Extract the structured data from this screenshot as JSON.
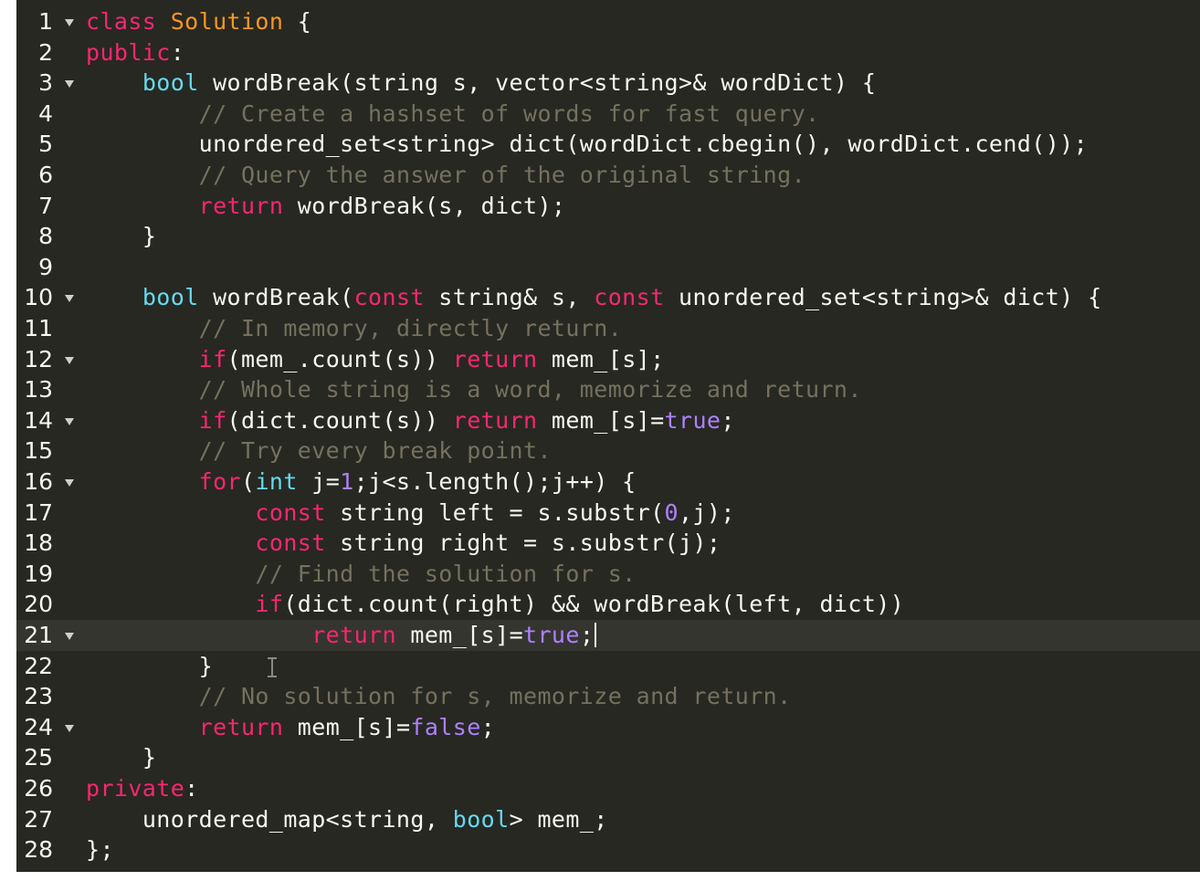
{
  "editor": {
    "language": "C++",
    "theme": "Monokai",
    "active_line": 21,
    "colors": {
      "background": "#272822",
      "active_line": "#353530",
      "keyword": "#f92672",
      "storage_type": "#66d9ef",
      "class_name": "#fd971f",
      "comment": "#75715e",
      "constant": "#ae81ff",
      "text": "#f8f8f2"
    },
    "lines": [
      {
        "n": "1",
        "fold": true,
        "indent": "",
        "tokens": [
          {
            "t": "class ",
            "c": "keyword"
          },
          {
            "t": "Solution",
            "c": "class"
          },
          {
            "t": " {",
            "c": "plain"
          }
        ]
      },
      {
        "n": "2",
        "fold": false,
        "indent": "",
        "tokens": [
          {
            "t": "public",
            "c": "keyword"
          },
          {
            "t": ":",
            "c": "plain"
          }
        ]
      },
      {
        "n": "3",
        "fold": true,
        "indent": "    ",
        "tokens": [
          {
            "t": "bool",
            "c": "storage"
          },
          {
            "t": " wordBreak(string s, vector<string>& wordDict) {",
            "c": "plain"
          }
        ]
      },
      {
        "n": "4",
        "fold": false,
        "indent": "        ",
        "tokens": [
          {
            "t": "// Create a hashset of words for fast query.",
            "c": "comment"
          }
        ]
      },
      {
        "n": "5",
        "fold": false,
        "indent": "        ",
        "tokens": [
          {
            "t": "unordered_set<string> dict(wordDict.cbegin(), wordDict.cend());",
            "c": "plain"
          }
        ]
      },
      {
        "n": "6",
        "fold": false,
        "indent": "        ",
        "tokens": [
          {
            "t": "// Query the answer of the original string.",
            "c": "comment"
          }
        ]
      },
      {
        "n": "7",
        "fold": false,
        "indent": "        ",
        "tokens": [
          {
            "t": "return",
            "c": "keyword"
          },
          {
            "t": " wordBreak(s, dict);",
            "c": "plain"
          }
        ]
      },
      {
        "n": "8",
        "fold": false,
        "indent": "    ",
        "tokens": [
          {
            "t": "}",
            "c": "plain"
          }
        ]
      },
      {
        "n": "9",
        "fold": false,
        "indent": "",
        "tokens": []
      },
      {
        "n": "10",
        "fold": true,
        "indent": "    ",
        "tokens": [
          {
            "t": "bool",
            "c": "storage"
          },
          {
            "t": " wordBreak(",
            "c": "plain"
          },
          {
            "t": "const",
            "c": "keyword"
          },
          {
            "t": " string& s, ",
            "c": "plain"
          },
          {
            "t": "const",
            "c": "keyword"
          },
          {
            "t": " unordered_set<string>& dict) {",
            "c": "plain"
          }
        ]
      },
      {
        "n": "11",
        "fold": false,
        "indent": "        ",
        "tokens": [
          {
            "t": "// In memory, directly return.",
            "c": "comment"
          }
        ]
      },
      {
        "n": "12",
        "fold": true,
        "indent": "        ",
        "tokens": [
          {
            "t": "if",
            "c": "keyword"
          },
          {
            "t": "(mem_.count(s)) ",
            "c": "plain"
          },
          {
            "t": "return",
            "c": "keyword"
          },
          {
            "t": " mem_[s];",
            "c": "plain"
          }
        ]
      },
      {
        "n": "13",
        "fold": false,
        "indent": "        ",
        "tokens": [
          {
            "t": "// Whole string is a word, memorize and return.",
            "c": "comment"
          }
        ]
      },
      {
        "n": "14",
        "fold": true,
        "indent": "        ",
        "tokens": [
          {
            "t": "if",
            "c": "keyword"
          },
          {
            "t": "(dict.count(s)) ",
            "c": "plain"
          },
          {
            "t": "return",
            "c": "keyword"
          },
          {
            "t": " mem_[s]=",
            "c": "plain"
          },
          {
            "t": "true",
            "c": "constant"
          },
          {
            "t": ";",
            "c": "plain"
          }
        ]
      },
      {
        "n": "15",
        "fold": false,
        "indent": "        ",
        "tokens": [
          {
            "t": "// Try every break point.",
            "c": "comment"
          }
        ]
      },
      {
        "n": "16",
        "fold": true,
        "indent": "        ",
        "tokens": [
          {
            "t": "for",
            "c": "keyword"
          },
          {
            "t": "(",
            "c": "plain"
          },
          {
            "t": "int",
            "c": "storage"
          },
          {
            "t": " j=",
            "c": "plain"
          },
          {
            "t": "1",
            "c": "constant"
          },
          {
            "t": ";j<s.length();j++) {",
            "c": "plain"
          }
        ]
      },
      {
        "n": "17",
        "fold": false,
        "indent": "            ",
        "tokens": [
          {
            "t": "const",
            "c": "keyword"
          },
          {
            "t": " string left = s.substr(",
            "c": "plain"
          },
          {
            "t": "0",
            "c": "constant"
          },
          {
            "t": ",j);",
            "c": "plain"
          }
        ]
      },
      {
        "n": "18",
        "fold": false,
        "indent": "            ",
        "tokens": [
          {
            "t": "const",
            "c": "keyword"
          },
          {
            "t": " string right = s.substr(j);",
            "c": "plain"
          }
        ]
      },
      {
        "n": "19",
        "fold": false,
        "indent": "            ",
        "tokens": [
          {
            "t": "// Find the solution for s.",
            "c": "comment"
          }
        ]
      },
      {
        "n": "20",
        "fold": false,
        "indent": "            ",
        "tokens": [
          {
            "t": "if",
            "c": "keyword"
          },
          {
            "t": "(dict.count(right) && wordBreak(left, dict))",
            "c": "plain"
          }
        ]
      },
      {
        "n": "21",
        "fold": true,
        "indent": "                ",
        "tokens": [
          {
            "t": "return",
            "c": "keyword"
          },
          {
            "t": " mem_[s]=",
            "c": "plain"
          },
          {
            "t": "true",
            "c": "constant"
          },
          {
            "t": ";",
            "c": "plain"
          }
        ]
      },
      {
        "n": "22",
        "fold": false,
        "indent": "        ",
        "tokens": [
          {
            "t": "}",
            "c": "plain"
          }
        ]
      },
      {
        "n": "23",
        "fold": false,
        "indent": "        ",
        "tokens": [
          {
            "t": "// No solution for s, memorize and return.",
            "c": "comment"
          }
        ]
      },
      {
        "n": "24",
        "fold": true,
        "indent": "        ",
        "tokens": [
          {
            "t": "return",
            "c": "keyword"
          },
          {
            "t": " mem_[s]=",
            "c": "plain"
          },
          {
            "t": "false",
            "c": "constant"
          },
          {
            "t": ";",
            "c": "plain"
          }
        ]
      },
      {
        "n": "25",
        "fold": false,
        "indent": "    ",
        "tokens": [
          {
            "t": "}",
            "c": "plain"
          }
        ]
      },
      {
        "n": "26",
        "fold": false,
        "indent": "",
        "tokens": [
          {
            "t": "private",
            "c": "keyword"
          },
          {
            "t": ":",
            "c": "plain"
          }
        ]
      },
      {
        "n": "27",
        "fold": false,
        "indent": "    ",
        "tokens": [
          {
            "t": "unordered_map<string, ",
            "c": "plain"
          },
          {
            "t": "bool",
            "c": "storage"
          },
          {
            "t": "> mem_;",
            "c": "plain"
          }
        ]
      },
      {
        "n": "28",
        "fold": false,
        "indent": "",
        "tokens": [
          {
            "t": "};",
            "c": "plain"
          }
        ]
      }
    ]
  }
}
